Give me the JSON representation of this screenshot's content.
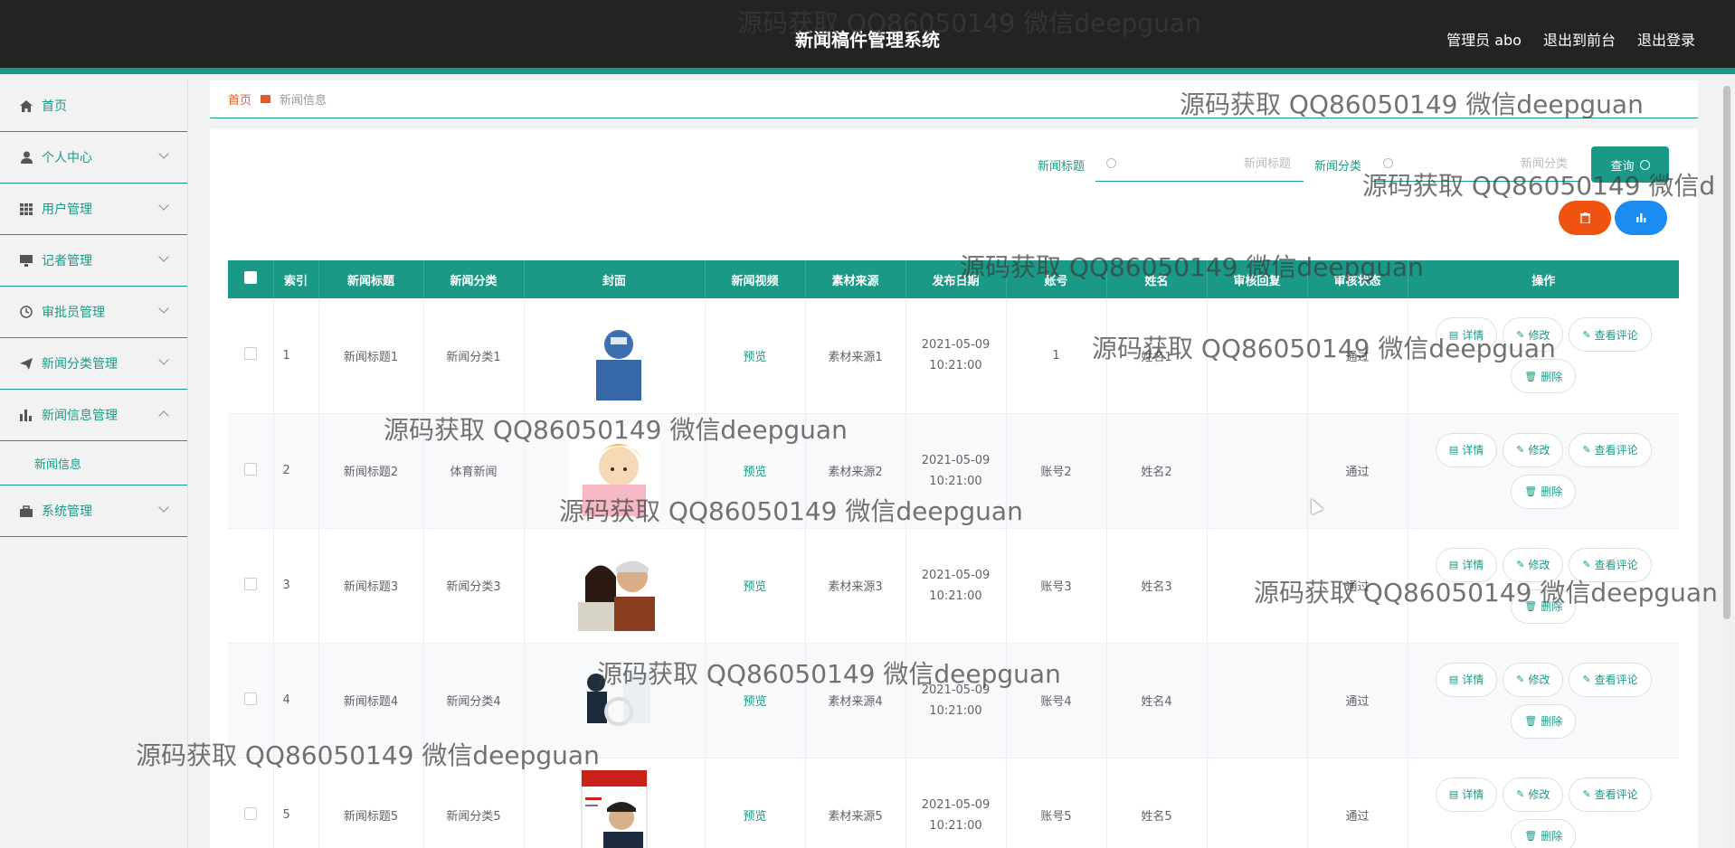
{
  "header": {
    "title": "新闻稿件管理系统",
    "user": "管理员 abo",
    "to_front": "退出到前台",
    "logout": "退出登录"
  },
  "sidebar": {
    "items": [
      {
        "label": "首页",
        "icon": "home-icon"
      },
      {
        "label": "个人中心",
        "icon": "user-icon"
      },
      {
        "label": "用户管理",
        "icon": "grid-icon"
      },
      {
        "label": "记者管理",
        "icon": "monitor-icon"
      },
      {
        "label": "审批员管理",
        "icon": "clock-icon"
      },
      {
        "label": "新闻分类管理",
        "icon": "send-icon"
      },
      {
        "label": "新闻信息管理",
        "icon": "chart-icon"
      },
      {
        "label": "系统管理",
        "icon": "briefcase-icon"
      }
    ],
    "submenu": "新闻信息"
  },
  "breadcrumb": {
    "home": "首页",
    "current": "新闻信息"
  },
  "search": {
    "title_label": "新闻标题",
    "title_placeholder": "新闻标题",
    "category_label": "新闻分类",
    "category_placeholder": "新闻分类",
    "query_label": "查询"
  },
  "table": {
    "headers": [
      "索引",
      "新闻标题",
      "新闻分类",
      "封面",
      "新闻视频",
      "素材来源",
      "发布日期",
      "账号",
      "姓名",
      "审核回复",
      "审核状态",
      "操作"
    ],
    "rows": [
      {
        "index": "1",
        "title": "新闻标题1",
        "category": "新闻分类1",
        "video": "预览",
        "source": "素材来源1",
        "date": "2021-05-09",
        "time": "10:21:00",
        "account": "1",
        "name": "姓名1",
        "reply": "",
        "status": "通过"
      },
      {
        "index": "2",
        "title": "新闻标题2",
        "category": "体育新闻",
        "video": "预览",
        "source": "素材来源2",
        "date": "2021-05-09",
        "time": "10:21:00",
        "account": "账号2",
        "name": "姓名2",
        "reply": "",
        "status": "通过"
      },
      {
        "index": "3",
        "title": "新闻标题3",
        "category": "新闻分类3",
        "video": "预览",
        "source": "素材来源3",
        "date": "2021-05-09",
        "time": "10:21:00",
        "account": "账号3",
        "name": "姓名3",
        "reply": "",
        "status": "通过"
      },
      {
        "index": "4",
        "title": "新闻标题4",
        "category": "新闻分类4",
        "video": "预览",
        "source": "素材来源4",
        "date": "2021-05-09",
        "time": "10:21:00",
        "account": "账号4",
        "name": "姓名4",
        "reply": "",
        "status": "通过"
      },
      {
        "index": "5",
        "title": "新闻标题5",
        "category": "新闻分类5",
        "video": "预览",
        "source": "素材来源5",
        "date": "2021-05-09",
        "time": "10:21:00",
        "account": "账号5",
        "name": "姓名5",
        "reply": "",
        "status": "通过"
      }
    ],
    "ops": {
      "detail": "详情",
      "edit": "修改",
      "comment": "查看评论",
      "delete": "删除"
    }
  },
  "watermark": "源码获取 QQ86050149 微信deepguan",
  "colors": {
    "accent": "#1a9a86",
    "header": "#232323",
    "danger": "#f0520f",
    "primary": "#1c8cf0"
  }
}
